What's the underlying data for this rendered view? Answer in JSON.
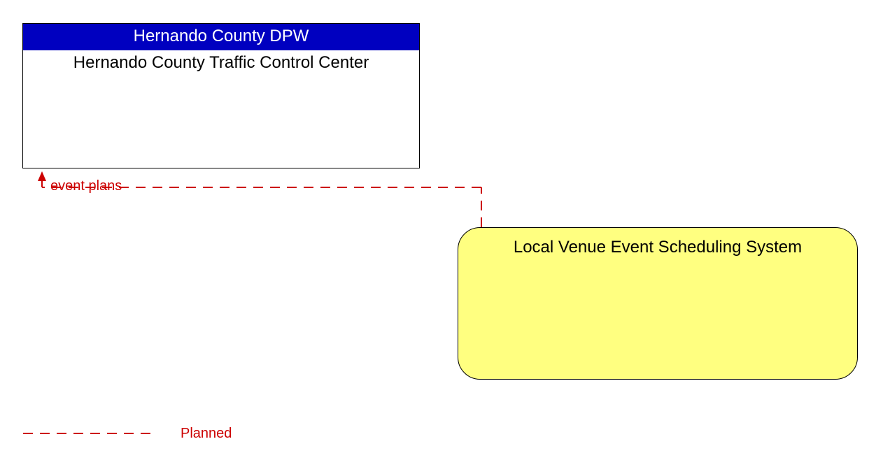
{
  "entity_box": {
    "header": "Hernando County DPW",
    "title": "Hernando County Traffic Control Center"
  },
  "venue_box": {
    "title": "Local Venue Event Scheduling System"
  },
  "flow": {
    "label": "event plans"
  },
  "legend": {
    "planned": "Planned"
  },
  "colors": {
    "planned_line": "#cc0000",
    "header_bg": "#0000c0",
    "venue_bg": "#ffff80"
  }
}
